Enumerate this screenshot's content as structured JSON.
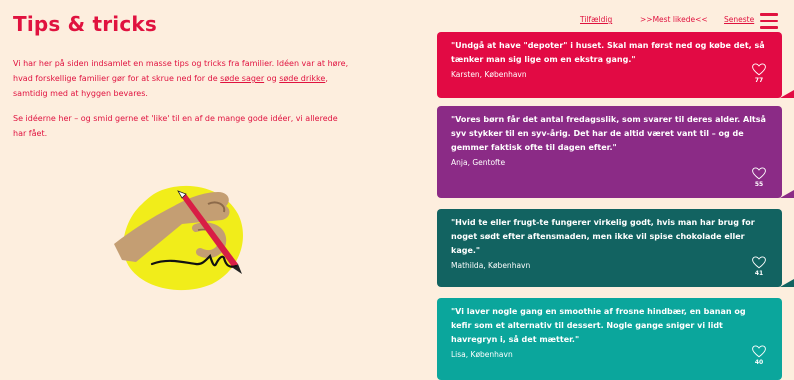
{
  "page": {
    "title": "Tips & tricks",
    "intro1_before": "Vi har her på siden indsamlet en masse tips og tricks fra familier. Idéen var at høre, hvad forskellige familier gør for at skrue ned for de ",
    "intro1_link1": "søde sager",
    "intro1_mid": " og ",
    "intro1_link2": "søde drikke",
    "intro1_after": ", samtidig med at hyggen bevares.",
    "intro2": "Se idéerne her – og smid gerne et 'like' til en af de mange gode idéer, vi allerede har fået."
  },
  "sort": {
    "random": "Tilfældig",
    "most_liked": ">>Mest likede<<",
    "latest": "Seneste"
  },
  "cards": [
    {
      "quote": "\"Undgå at have \"depoter\" i huset. Skal man først ned og købe det, så tænker man sig lige om en ekstra gang.\"",
      "author": "Karsten, København",
      "likes": "77",
      "color": "#e20a44"
    },
    {
      "quote": "\"Vores børn får det antal fredagsslik, som svarer til deres alder. Altså syv stykker til en syv-årig. Det har de altid været vant til – og de gemmer faktisk ofte til dagen efter.\"",
      "author": "Anja, Gentofte",
      "likes": "55",
      "color": "#8b2b86"
    },
    {
      "quote": "\"Hvid te eller frugt-te fungerer virkelig godt, hvis man har brug for noget sødt efter aftensmaden, men ikke vil spise chokolade eller kage.\"",
      "author": "Mathilda, København",
      "likes": "41",
      "color": "#126361"
    },
    {
      "quote": "\"Vi laver nogle gang en smoothie af frosne hindbær, en banan og kefir som et alternativ til dessert. Nogle gange sniger vi lidt havregryn i, så det mætter.\"",
      "author": "Lisa, København",
      "likes": "40",
      "color": "#0ba69c"
    }
  ]
}
